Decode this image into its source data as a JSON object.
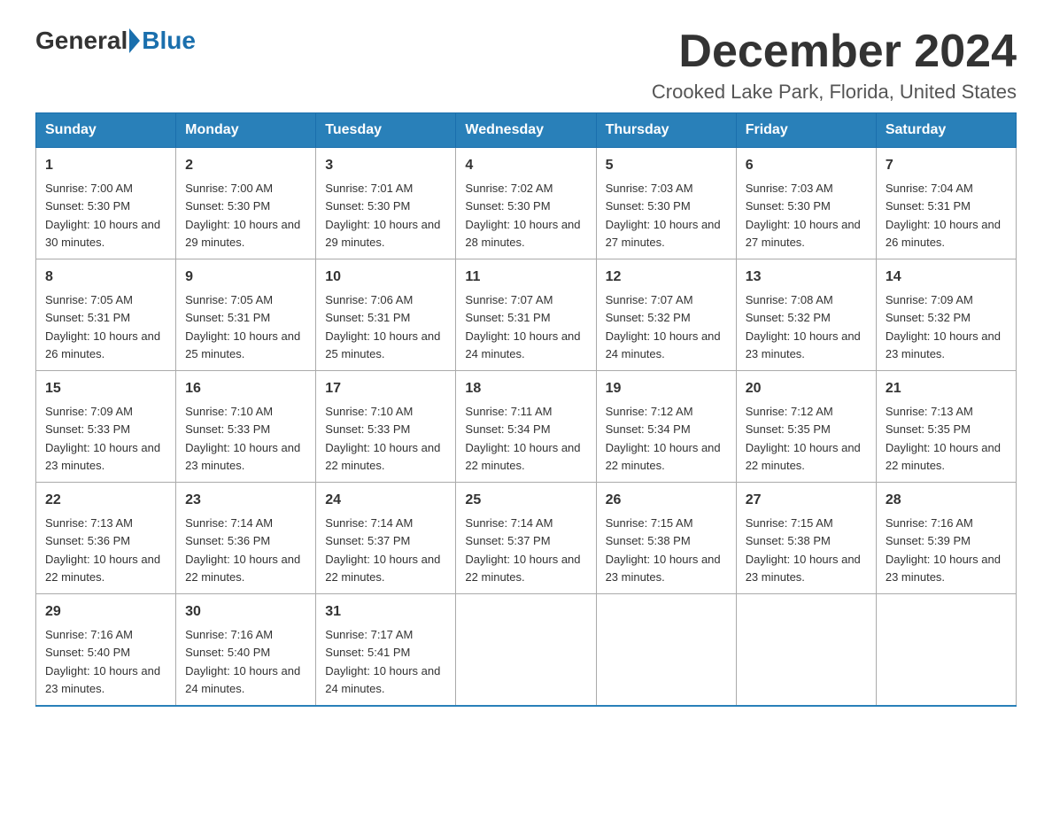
{
  "header": {
    "logo": {
      "part1": "General",
      "part2": "Blue"
    },
    "title": "December 2024",
    "location": "Crooked Lake Park, Florida, United States"
  },
  "calendar": {
    "days_of_week": [
      "Sunday",
      "Monday",
      "Tuesday",
      "Wednesday",
      "Thursday",
      "Friday",
      "Saturday"
    ],
    "weeks": [
      [
        {
          "day": "1",
          "sunrise": "7:00 AM",
          "sunset": "5:30 PM",
          "daylight": "10 hours and 30 minutes."
        },
        {
          "day": "2",
          "sunrise": "7:00 AM",
          "sunset": "5:30 PM",
          "daylight": "10 hours and 29 minutes."
        },
        {
          "day": "3",
          "sunrise": "7:01 AM",
          "sunset": "5:30 PM",
          "daylight": "10 hours and 29 minutes."
        },
        {
          "day": "4",
          "sunrise": "7:02 AM",
          "sunset": "5:30 PM",
          "daylight": "10 hours and 28 minutes."
        },
        {
          "day": "5",
          "sunrise": "7:03 AM",
          "sunset": "5:30 PM",
          "daylight": "10 hours and 27 minutes."
        },
        {
          "day": "6",
          "sunrise": "7:03 AM",
          "sunset": "5:30 PM",
          "daylight": "10 hours and 27 minutes."
        },
        {
          "day": "7",
          "sunrise": "7:04 AM",
          "sunset": "5:31 PM",
          "daylight": "10 hours and 26 minutes."
        }
      ],
      [
        {
          "day": "8",
          "sunrise": "7:05 AM",
          "sunset": "5:31 PM",
          "daylight": "10 hours and 26 minutes."
        },
        {
          "day": "9",
          "sunrise": "7:05 AM",
          "sunset": "5:31 PM",
          "daylight": "10 hours and 25 minutes."
        },
        {
          "day": "10",
          "sunrise": "7:06 AM",
          "sunset": "5:31 PM",
          "daylight": "10 hours and 25 minutes."
        },
        {
          "day": "11",
          "sunrise": "7:07 AM",
          "sunset": "5:31 PM",
          "daylight": "10 hours and 24 minutes."
        },
        {
          "day": "12",
          "sunrise": "7:07 AM",
          "sunset": "5:32 PM",
          "daylight": "10 hours and 24 minutes."
        },
        {
          "day": "13",
          "sunrise": "7:08 AM",
          "sunset": "5:32 PM",
          "daylight": "10 hours and 23 minutes."
        },
        {
          "day": "14",
          "sunrise": "7:09 AM",
          "sunset": "5:32 PM",
          "daylight": "10 hours and 23 minutes."
        }
      ],
      [
        {
          "day": "15",
          "sunrise": "7:09 AM",
          "sunset": "5:33 PM",
          "daylight": "10 hours and 23 minutes."
        },
        {
          "day": "16",
          "sunrise": "7:10 AM",
          "sunset": "5:33 PM",
          "daylight": "10 hours and 23 minutes."
        },
        {
          "day": "17",
          "sunrise": "7:10 AM",
          "sunset": "5:33 PM",
          "daylight": "10 hours and 22 minutes."
        },
        {
          "day": "18",
          "sunrise": "7:11 AM",
          "sunset": "5:34 PM",
          "daylight": "10 hours and 22 minutes."
        },
        {
          "day": "19",
          "sunrise": "7:12 AM",
          "sunset": "5:34 PM",
          "daylight": "10 hours and 22 minutes."
        },
        {
          "day": "20",
          "sunrise": "7:12 AM",
          "sunset": "5:35 PM",
          "daylight": "10 hours and 22 minutes."
        },
        {
          "day": "21",
          "sunrise": "7:13 AM",
          "sunset": "5:35 PM",
          "daylight": "10 hours and 22 minutes."
        }
      ],
      [
        {
          "day": "22",
          "sunrise": "7:13 AM",
          "sunset": "5:36 PM",
          "daylight": "10 hours and 22 minutes."
        },
        {
          "day": "23",
          "sunrise": "7:14 AM",
          "sunset": "5:36 PM",
          "daylight": "10 hours and 22 minutes."
        },
        {
          "day": "24",
          "sunrise": "7:14 AM",
          "sunset": "5:37 PM",
          "daylight": "10 hours and 22 minutes."
        },
        {
          "day": "25",
          "sunrise": "7:14 AM",
          "sunset": "5:37 PM",
          "daylight": "10 hours and 22 minutes."
        },
        {
          "day": "26",
          "sunrise": "7:15 AM",
          "sunset": "5:38 PM",
          "daylight": "10 hours and 23 minutes."
        },
        {
          "day": "27",
          "sunrise": "7:15 AM",
          "sunset": "5:38 PM",
          "daylight": "10 hours and 23 minutes."
        },
        {
          "day": "28",
          "sunrise": "7:16 AM",
          "sunset": "5:39 PM",
          "daylight": "10 hours and 23 minutes."
        }
      ],
      [
        {
          "day": "29",
          "sunrise": "7:16 AM",
          "sunset": "5:40 PM",
          "daylight": "10 hours and 23 minutes."
        },
        {
          "day": "30",
          "sunrise": "7:16 AM",
          "sunset": "5:40 PM",
          "daylight": "10 hours and 24 minutes."
        },
        {
          "day": "31",
          "sunrise": "7:17 AM",
          "sunset": "5:41 PM",
          "daylight": "10 hours and 24 minutes."
        },
        null,
        null,
        null,
        null
      ]
    ]
  }
}
